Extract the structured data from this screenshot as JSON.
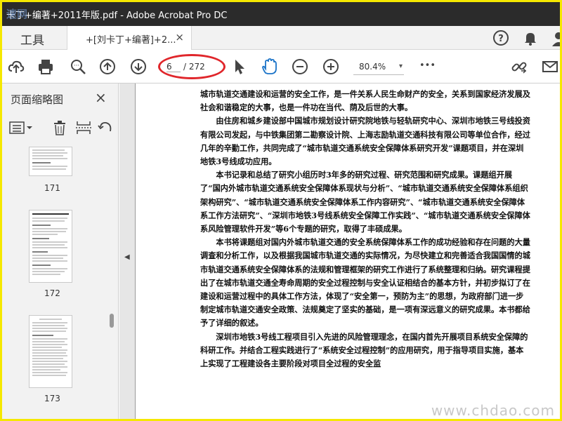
{
  "window": {
    "title": "卡丁+编著+2011年版.pdf - Adobe Acrobat Pro DC",
    "watermark_logo": "速网"
  },
  "tabs": {
    "tools_label": "工具",
    "doc_label": "+[刘卡丁+编著]+2...",
    "close": "×"
  },
  "toolbar": {
    "page_current": "6",
    "page_total": "/ 272",
    "zoom": "80.4%",
    "zoom_arrow": "▾",
    "more": "•••"
  },
  "sidepanel": {
    "title": "页面缩略图",
    "close": "×",
    "thumbnails": [
      {
        "page": "171"
      },
      {
        "page": "172"
      },
      {
        "page": "173"
      }
    ]
  },
  "document": {
    "paragraphs": [
      {
        "indent": false,
        "text": "城市轨道交通建设和运营的安全工作，是一件关系人民生命财产的安全，关系到国家经济发展及社会和谐稳定的大事，也是一件功在当代、荫及后世的大事。"
      },
      {
        "indent": true,
        "text": "由住房和城乡建设部中国城市规划设计研究院地铁与轻轨研究中心、深圳市地铁三号线投资有限公司发起，与中铁集团第二勘察设计院、上海志励轨道交通科技有限公司等单位合作，经过几年的辛勤工作，共同完成了“城市轨道交通系统安全保障体系研究开发”课题项目，并在深圳地铁3号线成功应用。"
      },
      {
        "indent": true,
        "text": "本书记录和总结了研究小组历时3年多的研究过程、研究范围和研究成果。课题组开展了“国内外城市轨道交通系统安全保障体系现状与分析”、“城市轨道交通系统安全保障体系组织架构研究”、“城市轨道交通系统安全保障体系工作内容研究”、“城市轨道交通系统安全保障体系工作方法研究”、“深圳市地铁3号线系统安全保障工作实践”、“城市轨道交通系统安全保障体系风险管理软件开发”等6个专题的研究，取得了丰硕成果。"
      },
      {
        "indent": true,
        "text": "本书将课题组对国内外城市轨道交通的安全系统保障体系工作的成功经验和存在问题的大量调查和分析工作，以及根据我国城市轨道交通的实际情况，为尽快建立和完善适合我国国情的城市轨道交通系统安全保障体系的法规和管理框架的研究工作进行了系统整理和归纳。研究课程提出了在城市轨道交通全寿命周期的安全过程控制与安全认证相结合的基本方针，并初步拟订了在建设和运营过程中的具体工作方法，体现了“安全第一，预防为主”的思想，为政府部门进一步制定城市轨道交通安全政策、法规奠定了坚实的基础，是一项有深远意义的研究成果。本书都给予了详细的叙述。"
      },
      {
        "indent": true,
        "text": "深圳市地铁3号线工程项目引入先进的风险管理理念，在国内首先开展项目系统安全保障的科研工作。并结合工程实践进行了“系统安全过程控制”的应用研究，用于指导项目实施，基本上实现了工程建设各主要阶段对项目全过程的安全监"
      }
    ],
    "watermark": "www.chdao.com"
  }
}
